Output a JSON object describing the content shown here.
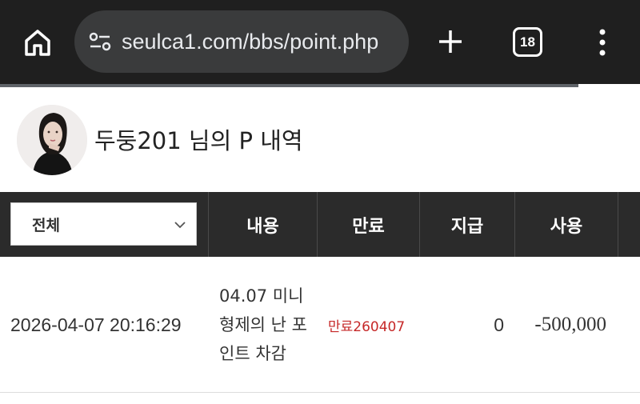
{
  "browser": {
    "url": "seulca1.com/bbs/point.php",
    "tab_count": "18",
    "icons": {
      "home": "home-icon",
      "site_settings": "tune-icon",
      "new_tab": "plus-icon",
      "menu": "more-vert-icon"
    }
  },
  "profile": {
    "title": "두둥201 님의 P 내역"
  },
  "table": {
    "filter": {
      "selected": "전체"
    },
    "headers": {
      "content": "내용",
      "expiry": "만료",
      "give": "지급",
      "use": "사용"
    },
    "rows": [
      {
        "datetime": "2026-04-07 20:16:29",
        "content": "04.07 미니 형제의 난 포인트 차감",
        "expiry": "만료260407",
        "give": "0",
        "use": "-500,000"
      }
    ]
  },
  "colors": {
    "browser_bg": "#1f1f1f",
    "url_pill": "#3a3b3c",
    "table_header": "#2b2b2b",
    "expiry_red": "#c62828"
  }
}
